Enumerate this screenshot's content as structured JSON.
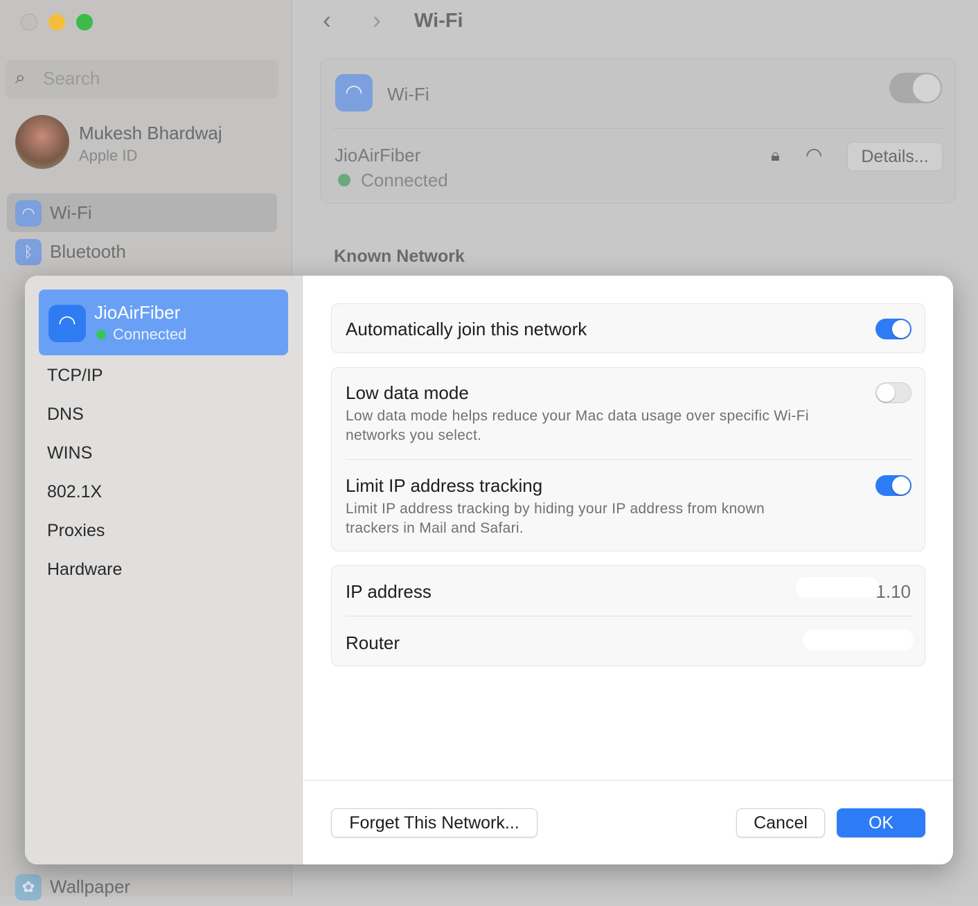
{
  "window": {
    "title": "Wi-Fi"
  },
  "sidebar": {
    "search_placeholder": "Search",
    "user": {
      "name": "Mukesh Bhardwaj",
      "subtitle": "Apple ID"
    },
    "items": [
      {
        "label": "Wi-Fi",
        "icon": "wifi-icon"
      },
      {
        "label": "Bluetooth",
        "icon": "bluetooth-icon"
      },
      {
        "label": "Wallpaper",
        "icon": "flower-icon"
      }
    ]
  },
  "main": {
    "wifi_label": "Wi-Fi",
    "wifi_enabled": true,
    "network_name": "JioAirFiber",
    "network_status": "Connected",
    "details_label": "Details...",
    "known_network_heading": "Known Network"
  },
  "sheet": {
    "network": {
      "name": "JioAirFiber",
      "status": "Connected"
    },
    "nav": [
      "TCP/IP",
      "DNS",
      "WINS",
      "802.1X",
      "Proxies",
      "Hardware"
    ],
    "auto_join": {
      "label": "Automatically join this network",
      "on": true
    },
    "low_data": {
      "label": "Low data mode",
      "desc1": "Low data mode helps reduce your Mac data usage over specific Wi-Fi",
      "desc2": "networks you select.",
      "on": false
    },
    "limit_ip": {
      "label": "Limit IP address tracking",
      "desc1": "Limit IP address tracking by hiding your IP address from known",
      "desc2": "trackers in Mail and Safari.",
      "on": true
    },
    "ip_label": "IP address",
    "ip_value": "1.10",
    "router_label": "Router",
    "forget_label": "Forget This Network...",
    "cancel_label": "Cancel",
    "ok_label": "OK"
  },
  "colors": {
    "accent": "#2d7cf6",
    "selection": "#69a0f5",
    "connected": "#34c759"
  }
}
